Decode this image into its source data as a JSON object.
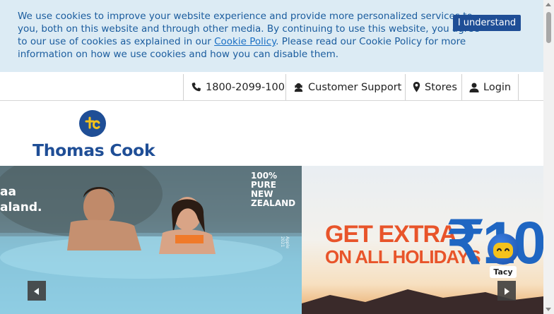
{
  "cookie_banner": {
    "text_before_link": "We use cookies to improve your website experience and provide more personalized services to you, both on this website and through other media. By continuing to use this website, you agree to our use of cookies as explained in our ",
    "link_text": "Cookie Policy",
    "text_after_link": ". Please read our Cookie Policy for more information on how we use cookies and how you can disable them.",
    "button_label": "I understand"
  },
  "utility_bar": {
    "phone": "1800-2099-100",
    "support": "Customer Support",
    "stores": "Stores",
    "login": "Login"
  },
  "logo": {
    "brand_name": "Thomas Cook"
  },
  "hero": {
    "left_slide": {
      "tagline_line1": "aa",
      "tagline_line2": "aland.",
      "badge_line1": "100% PURE",
      "badge_line2": "NEW ZEALAND",
      "photo_credit": "Apple 2021"
    },
    "right_slide": {
      "promo_line1": "GET EXTRA",
      "promo_line2": "ON ALL HOLIDAYS",
      "amount": "₹100"
    }
  },
  "chat_assistant": {
    "name": "Tacy"
  },
  "colors": {
    "brand_blue": "#1f4e96",
    "link_blue": "#1a6fc4",
    "promo_orange": "#e8542a",
    "cookie_bg": "#dcebf4"
  }
}
